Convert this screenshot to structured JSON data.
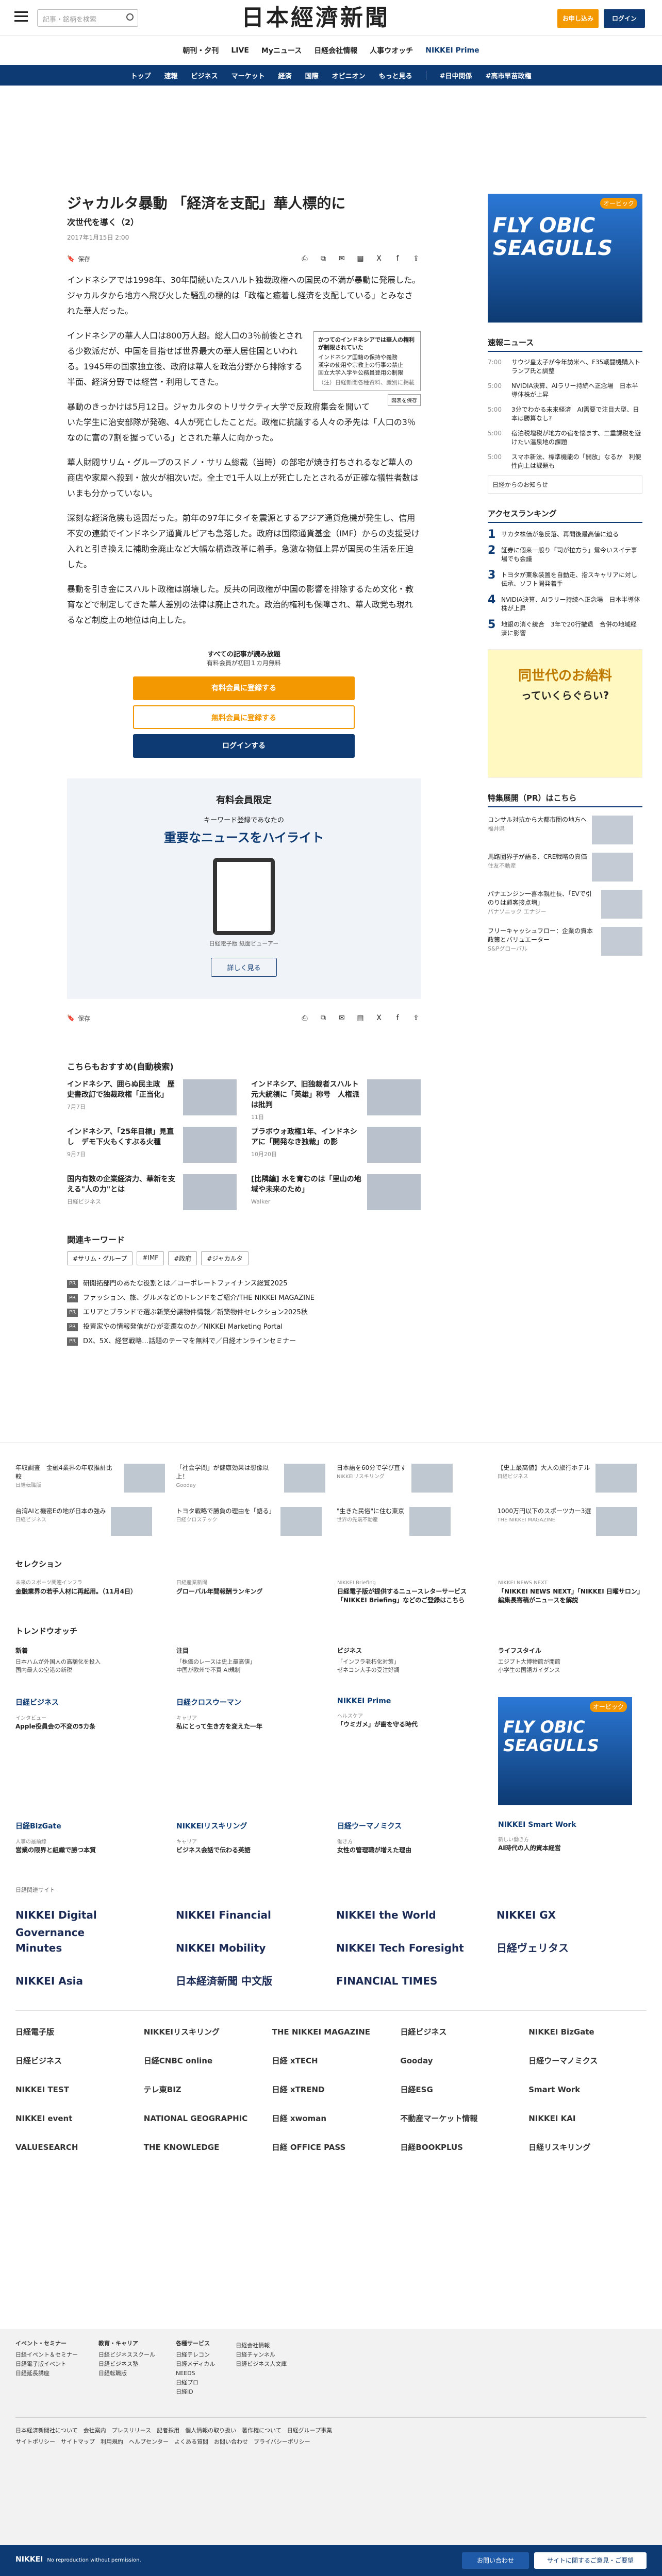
{
  "header": {
    "search_placeholder": "記事・銘柄を検索",
    "logo": "日本經濟新聞",
    "subscribe": "お申し込み",
    "login": "ログイン"
  },
  "subnav": [
    "朝刊・夕刊",
    "LIVE",
    "Myニュース",
    "日経会社情報",
    "人事ウオッチ",
    "NIKKEI Prime"
  ],
  "navbar": [
    "トップ",
    "速報",
    "ビジネス",
    "マーケット",
    "経済",
    "国際",
    "オピニオン",
    "もっと見る",
    "#日中関係",
    "#高市早苗政権"
  ],
  "article": {
    "title": "ジャカルタ暴動 「経済を支配」華人標的に",
    "subtitle": "次世代を導く（2）",
    "date": "2017年1月15日 2:00",
    "save": "保存",
    "lead": "インドネシアでは1998年、30年間続いたスハルト独裁政権への国民の不満が暴動に発展した。ジャカルタから地方へ飛び火した騒乱の標的は「政権と癒着し経済を支配している」とみなされた華人だった。",
    "p1": "インドネシアの華人人口は800万人超。総人口の3％前後とされる少数派だが、中国を目指せば世界最大の華人居住国といわれる。1945年の国家独立後、政府は華人を政治分野から排除する半面、経済分野では経営・利用してきた。",
    "p2": "暴動のきっかけは5月12日。ジャカルタのトリサクティ大学で反政府集会を開いていた学生に治安部隊が発砲、4人が死亡したことだ。政権に抗議する人々の矛先は「人口の3％なのに富の7割を握っている」とされた華人に向かった。",
    "p3": "華人財閥サリム・グループのスドノ・サリム総裁（当時）の部宅が焼き打ちされるなど華人の商店や家屋へ殺到・放火が相次いだ。全土で1千人以上が死亡したとされるが正確な犠牲者数はいまも分かっていない。",
    "p4": "深刻な経済危機も遠因だった。前年の97年にタイを震源とするアジア通貨危機が発生し、信用不安の連鎖でインドネシア通貨ルピアも急落した。政府は国際通貨基金（IMF）からの支援受け入れと引き換えに補助金廃止など大幅な構造改革に着手。急激な物価上昇が国民の生活を圧迫した。",
    "p5": "暴動を引き金にスハルト政権は崩壊した。反共の同政権が中国の影響を排除するため文化・教育などで制定してきた華人差別の法律は廃止された。政治的権利も保障され、華人政党も現れるなど制度上の地位は向上した。",
    "factbox_title": "かつてのインドネシアでは華人の権利が制限されていた",
    "factbox_items": [
      "インドネシア国籍の保持や義務",
      "漢字の使用や宗教上の行事の禁止",
      "国立大学入学や公務員登用の制限"
    ],
    "factbox_source": "（注）日経新聞各種資料、識別に掲載",
    "zoom": "図表を保存",
    "pw1": "すべての記事が読み放題",
    "pw2": "有料会員が初回１カ月無料",
    "pw_btn1": "有料会員に登録する",
    "pw_btn2": "無料会員に登録する",
    "pw_btn3": "ログインする",
    "promo_title": "有料会員限定",
    "promo_sub": "キーワード登録であなたの",
    "promo_big": "重要なニュースをハイライト",
    "promo_cap": "日経電子版 紙面ビューアー",
    "promo_more": "詳しく見る"
  },
  "recommend": {
    "title": "こちらもおすすめ(自動検索)",
    "items": [
      {
        "t": "インドネシア、囲らぬ民主政　歴史書改訂で独裁政権「正当化」",
        "d": "7月7日"
      },
      {
        "t": "インドネシア、旧独裁者スハルト元大統領に「英雄」称号　人権派は批判",
        "d": "11日"
      },
      {
        "t": "インドネシア、「25年目標」見直し　デモ下火もくすぶる火種",
        "d": "9月7日"
      },
      {
        "t": "プラボウォ政権1年、インドネシアに「開発なき独裁」の影",
        "d": "10月20日"
      },
      {
        "t": "国内有数の企業経済力、華新を支える\"人の力\"とは",
        "d": "日経ビジネス"
      },
      {
        "t": "[比隣編] 水を育むのは「里山の地域や未来のため」",
        "d": "Walker"
      }
    ]
  },
  "keywords": {
    "title": "関連キーワード",
    "items": [
      "#サリム・グループ",
      "#IMF",
      "#政府",
      "#ジャカルタ"
    ]
  },
  "prlist": [
    "研開拓部門のあたな役割とは／コーポレートファイナンス総覧2025",
    "ファッション、旅、グルメなどのトレンドをご紹介/THE NIKKEI MAGAZINE",
    "エリアとブランドで選ぶ新築分譲物件情報／新築物件セレクション2025秋",
    "投資家やの情報発信がひが変遷なのか／NIKKEI Marketing Portal",
    "DX、5X、経営戦略…話題のテーマを無料で／日経オンラインセミナー"
  ],
  "side": {
    "ad_badge": "オービック",
    "ad_text": "FLY OBIC SEAGULLS",
    "news_title": "速報ニュース",
    "news": [
      {
        "tm": "7:00",
        "t": "サウジ皇太子が今年訪米へ、F35戦闘機購入トランプ氏と調整"
      },
      {
        "tm": "5:00",
        "t": "NVIDIA決算、AIラリー持続へ正念場　日本半導体株が上昇"
      },
      {
        "tm": "5:00",
        "t": "3分でわかる未来経済　AI需要で注目大型、日本は勝算なし?"
      },
      {
        "tm": "5:00",
        "t": "宿泊税増税が地方の宿を悩ます、二重課税を避けたい温泉地の課題"
      },
      {
        "tm": "5:00",
        "t": "スマホ新法、標準機能の「開放」なるか　利便性向上は課題も"
      }
    ],
    "nikkei_line": "日経からのお知らせ",
    "ranking_title": "アクセスランキング",
    "ranking": [
      "サカタ株価が急反落、再開後最高値に迫る",
      "証券に個来一般り「司が拉方う」鴛今いスイテ事場でも会議",
      "トヨタが東象装置を自動走、指スキャリアに対し伝承、ソフト開発着手",
      "NVIDIA決算、AIラリー持続へ正念場　日本半導体株が上昇",
      "地銀の消ぐ統合　3年で20行撤退　合併の地域経済に影響"
    ],
    "yellow1": "同世代のお給料",
    "yellow2": "っていくらぐらい?",
    "sp_title": "特集展開（PR）はこちら",
    "sp": [
      {
        "t": "コンサル対抗から大都市圏の地方へ",
        "s": "福井県"
      },
      {
        "t": "馬路圏界子が語る、CRE戦略の真価",
        "s": "住友不動産"
      },
      {
        "t": "パナエンジン一喜本親社長、「EVで引のりは顧客接点増」",
        "s": "パナソニック エナジー"
      },
      {
        "t": "フリーキャッシュフロー：企業の資本政策とバリュエーター",
        "s": "S&Pグローバル"
      }
    ]
  },
  "row1": [
    {
      "t": "年収調査　金融4業界の年収推計比較",
      "s": "日経転職版"
    },
    {
      "t": "「社会学問」が健康効果は想像以上！",
      "s": "Gooday"
    },
    {
      "t": "日本語を60分で学び直す",
      "s": "NIKKEIリスキリング"
    },
    {
      "t": "【史上最高値】大人の旅行ホテル",
      "s": "日経ビジネス"
    }
  ],
  "row2": [
    {
      "t": "台湾AIと機密Eの地が日本の強み",
      "s": "日経ビジネス"
    },
    {
      "t": "トヨタ戦略で勝負の理由を「語る」",
      "s": "日経クロステック"
    },
    {
      "t": "\"生きた民俗\"に住む東京",
      "s": "世界の先端不動産"
    },
    {
      "t": "1000万円以下のスポーツカー3選",
      "s": "THE NIKKEI MAGAZINE"
    }
  ],
  "selection": {
    "title": "セレクション",
    "items": [
      {
        "s": "未来のスポーツ関連インフラ",
        "t": "金融業界の若手人材に再起用。（11月4日）"
      },
      {
        "s": "日経産業新聞",
        "t": "グローバル年間報酬ランキング"
      },
      {
        "s": "NIKKEI Briefing",
        "t": "日経電子版が提供するニュースレターサービス「NIKKEI Briefing」などのご登録はこちら"
      },
      {
        "s": "NIKKEI NEWS NEXT",
        "t": "「NIKKEI NEWS NEXT」「NIKKEI 日曜サロン」編集長寄稿がニュースを解説"
      }
    ]
  },
  "trend": {
    "title": "トレンドウオッチ",
    "cols": [
      {
        "h": "新着",
        "t": "日本ハムが外国人の高額化を投入",
        "t2": "国内最大の空港の新税"
      },
      {
        "h": "注目",
        "t": "「株価のレースは史上最高値」",
        "t2": "中国が欧州で不買 AI規制"
      },
      {
        "h": "ビジネス",
        "t": "「インフラ老朽化対策」",
        "t2": "ゼネコン大手の受注好調"
      },
      {
        "h": "ライフスタイル",
        "t": "エジプト大博物館が開館",
        "t2": "小学生の国語ガイダンス"
      }
    ]
  },
  "brands": [
    {
      "h": "日経ビジネス",
      "s": "インタビュー",
      "t": "Apple役員会の不変の5カ条"
    },
    {
      "h": "日経クロスウーマン",
      "s": "キャリア",
      "t": "私にとって生き方を変えた一年"
    },
    {
      "h": "NIKKEI Prime",
      "s": "ヘルスケア",
      "t": "「ウミガメ」が歯を守る時代"
    },
    {
      "h": "",
      "s": "",
      "t": ""
    }
  ],
  "brands2": [
    {
      "h": "日経BizGate",
      "s": "人事の最前線",
      "t": "営業の限界と組織で勝つ本質"
    },
    {
      "h": "NIKKEIリスキリング",
      "s": "キャリア",
      "t": "ビジネス会話で伝わる英語"
    },
    {
      "h": "日経ウーマノミクス",
      "s": "働き方",
      "t": "女性の管理職が増えた理由"
    },
    {
      "h": "NIKKEI Smart Work",
      "s": "新しい働き方",
      "t": "AI時代の人的資本経営"
    }
  ],
  "logos_head": "日経関連サイト",
  "logos1": [
    "NIKKEI Digital Governance",
    "NIKKEI Financial",
    "NIKKEI the World",
    "NIKKEI GX"
  ],
  "logos2": [
    "Minutes",
    "NIKKEI Mobility",
    "NIKKEI Tech Foresight",
    "日経ヴェリタス"
  ],
  "logos3": [
    "NIKKEI Asia",
    "日本経済新聞 中文版",
    "FINANCIAL TIMES",
    ""
  ],
  "logos4": [
    "日経電子版",
    "NIKKEIリスキリング",
    "THE NIKKEI MAGAZINE",
    "日経ビジネス",
    "NIKKEI BizGate",
    "日経ビジネス",
    "日経CNBC online",
    "日経 xTECH",
    "Gooday",
    "日経ウーマノミクス",
    "NIKKEI TEST",
    "テレ東BIZ",
    "日経 xTREND",
    "日経ESG",
    "Smart Work",
    "NIKKEI event",
    "NATIONAL GEOGRAPHIC",
    "日経 xwoman",
    "不動産マーケット情報",
    "NIKKEI KAI",
    "VALUESEARCH",
    "THE KNOWLEDGE",
    "日経 OFFICE PASS",
    "日経BOOKPLUS",
    "日経リスキリング"
  ],
  "footer": {
    "c1h": "イベント・セミナー",
    "c1": [
      "日経イベント＆セミナー",
      "日経電子版イベント",
      "日経延長講座"
    ],
    "c2h": "教育・キャリア",
    "c2": [
      "日経ビジネススクール",
      "日経ビジネス塾",
      "日経転職版"
    ],
    "c3h": "各種サービス",
    "c3": [
      "日経テレコン",
      "日経メディカル",
      "NEEDS",
      "日経プロ",
      "日経ID"
    ],
    "c4h": "",
    "c4": [
      "日経会社情報",
      "日経チャンネル",
      "日経ビジネス人文庫"
    ],
    "links1": "日本経済新聞社について　会社案内　プレスリリース　記者採用　個人情報の取り扱い　著作権について　日経グループ事業",
    "links2": "サイトポリシー　サイトマップ　利用規約　ヘルプセンター　よくある質問　お問い合わせ　プライバシーポリシー"
  },
  "bottom": {
    "logo": "NIKKEI",
    "note": "No reproduction without permission.",
    "b1": "お問い合わせ",
    "b2": "サイトに関するご意見・ご要望"
  }
}
